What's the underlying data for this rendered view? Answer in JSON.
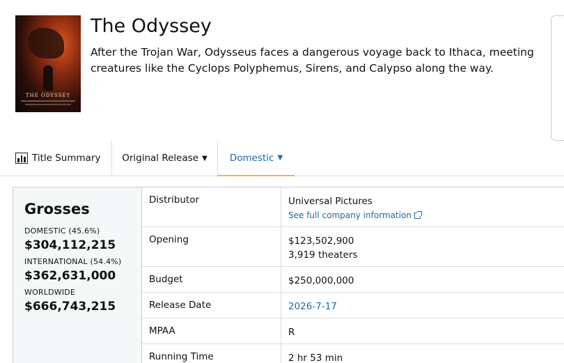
{
  "movie": {
    "title": "The Odyssey",
    "synopsis": "After the Trojan War, Odysseus faces a dangerous voyage back to Ithaca, meeting creatures like the Cyclops Polyphemus, Sirens, and Calypso along the way.",
    "poster_title": "THE ODYSSEY"
  },
  "tabs": {
    "summary": "Title Summary",
    "original": "Original Release",
    "domestic": "Domestic",
    "active": "domestic"
  },
  "grosses": {
    "heading": "Grosses",
    "domestic_label": "DOMESTIC (45.6%)",
    "domestic_value": "$304,112,215",
    "international_label": "INTERNATIONAL (54.4%)",
    "international_value": "$362,631,000",
    "worldwide_label": "WORLDWIDE",
    "worldwide_value": "$666,743,215"
  },
  "details": {
    "distributor_label": "Distributor",
    "distributor_value": "Universal Pictures",
    "distributor_link": "See full company information",
    "opening_label": "Opening",
    "opening_value": "$123,502,900",
    "opening_theaters": "3,919 theaters",
    "budget_label": "Budget",
    "budget_value": "$250,000,000",
    "release_label": "Release Date",
    "release_value": "2026-7-17",
    "mpaa_label": "MPAA",
    "mpaa_value": "R",
    "runtime_label": "Running Time",
    "runtime_value": "2 hr 53 min"
  },
  "colors": {
    "link": "#1a6aa6",
    "active_tab_underline": "#e7b94c",
    "grosses_bg": "#f4f8f8"
  }
}
